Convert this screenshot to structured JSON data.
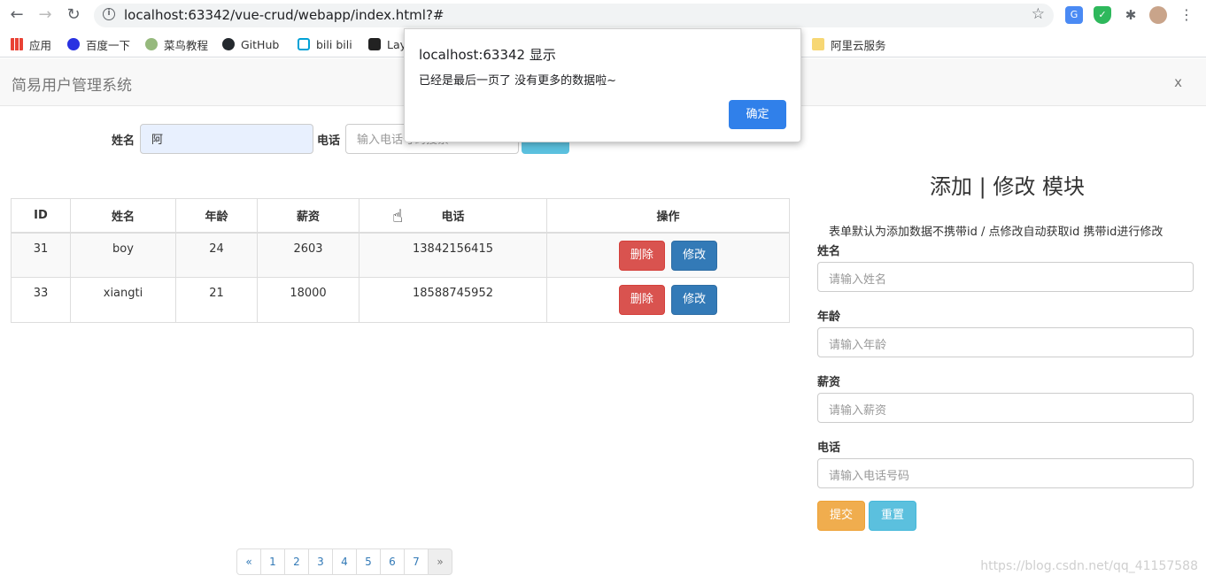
{
  "browser": {
    "url": "localhost:63342/vue-crud/webapp/index.html?#",
    "bookmarks": [
      "应用",
      "百度一下",
      "菜鸟教程",
      "GitHub",
      "bili bili",
      "Lay",
      "阿里云服务"
    ]
  },
  "header": {
    "brand": "简易用户管理系统",
    "close": "x"
  },
  "search": {
    "name_label": "姓名",
    "name_value": "阿",
    "phone_label": "电话",
    "phone_placeholder": "输入电话号码搜索"
  },
  "table": {
    "headers": [
      "ID",
      "姓名",
      "年龄",
      "薪资",
      "电话",
      "操作"
    ],
    "rows": [
      {
        "id": "31",
        "name": "boy",
        "age": "24",
        "salary": "2603",
        "phone": "13842156415"
      },
      {
        "id": "33",
        "name": "xiangti",
        "age": "21",
        "salary": "18000",
        "phone": "18588745952"
      }
    ],
    "delete_label": "删除",
    "edit_label": "修改"
  },
  "pagination": [
    "«",
    "1",
    "2",
    "3",
    "4",
    "5",
    "6",
    "7",
    "»"
  ],
  "form": {
    "title": "添加 | 修改 模块",
    "note": "表单默认为添加数据不携带id / 点修改自动获取id 携带id进行修改",
    "fields": [
      {
        "label": "姓名",
        "placeholder": "请输入姓名"
      },
      {
        "label": "年龄",
        "placeholder": "请输入年龄"
      },
      {
        "label": "薪资",
        "placeholder": "请输入薪资"
      },
      {
        "label": "电话",
        "placeholder": "请输入电话号码"
      }
    ],
    "submit_label": "提交",
    "reset_label": "重置"
  },
  "dialog": {
    "title": "localhost:63342 显示",
    "message": "已经是最后一页了 没有更多的数据啦~",
    "ok_label": "确定"
  },
  "watermark": "https://blog.csdn.net/qq_41157588"
}
